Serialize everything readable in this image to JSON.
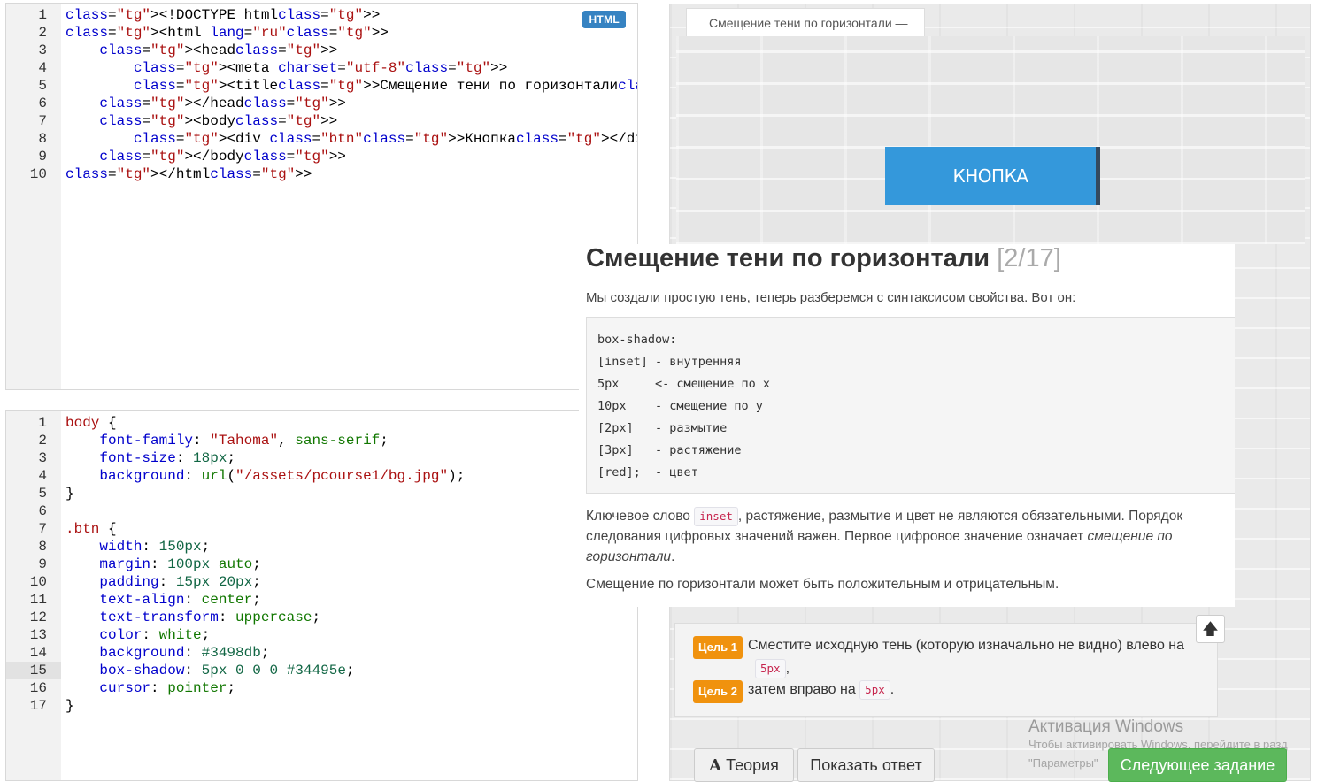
{
  "html_editor": {
    "badge": "HTML",
    "lines": [
      {
        "n": "1",
        "code": "<!DOCTYPE html>"
      },
      {
        "n": "2",
        "code": "<html lang=\"ru\">"
      },
      {
        "n": "3",
        "code": "    <head>"
      },
      {
        "n": "4",
        "code": "        <meta charset=\"utf-8\">"
      },
      {
        "n": "5",
        "code": "        <title>Смещение тени по горизонтали</title>"
      },
      {
        "n": "6",
        "code": "    </head>"
      },
      {
        "n": "7",
        "code": "    <body>"
      },
      {
        "n": "8",
        "code": "        <div class=\"btn\">Кнопка</div>"
      },
      {
        "n": "9",
        "code": "    </body>"
      },
      {
        "n": "10",
        "code": "</html>"
      }
    ]
  },
  "css_editor": {
    "active_line": 15,
    "lines": [
      {
        "n": "1",
        "code": "body {"
      },
      {
        "n": "2",
        "code": "    font-family: \"Tahoma\", sans-serif;"
      },
      {
        "n": "3",
        "code": "    font-size: 18px;"
      },
      {
        "n": "4",
        "code": "    background: url(\"/assets/pcourse1/bg.jpg\");"
      },
      {
        "n": "5",
        "code": "}"
      },
      {
        "n": "6",
        "code": ""
      },
      {
        "n": "7",
        "code": ".btn {"
      },
      {
        "n": "8",
        "code": "    width: 150px;"
      },
      {
        "n": "9",
        "code": "    margin: 100px auto;"
      },
      {
        "n": "10",
        "code": "    padding: 15px 20px;"
      },
      {
        "n": "11",
        "code": "    text-align: center;"
      },
      {
        "n": "12",
        "code": "    text-transform: uppercase;"
      },
      {
        "n": "13",
        "code": "    color: white;"
      },
      {
        "n": "14",
        "code": "    background: #3498db;"
      },
      {
        "n": "15",
        "code": "    box-shadow: 5px 0 0 0 #34495e;"
      },
      {
        "n": "16",
        "code": "    cursor: pointer;"
      },
      {
        "n": "17",
        "code": "}"
      }
    ]
  },
  "preview": {
    "tab_title": "Смещение тени по горизонтали —",
    "button_label": "Кнопка"
  },
  "theory": {
    "title": "Смещение тени по горизонтали",
    "counter": "[2/17]",
    "intro": "Мы создали простую тень, теперь разберемся с синтаксисом свойства. Вот он:",
    "pre_lines": [
      "box-shadow:",
      "[inset] - внутренняя",
      "5px     <- смещение по x",
      "10px    - смещение по y",
      "[2px]   - размытие",
      "[3px]   - растяжение",
      "[red];  - цвет"
    ],
    "p2_before": "Ключевое слово ",
    "p2_code": "inset",
    "p2_after": ", растяжение, размытие и цвет не являются обязательными. Порядок следования цифровых значений важен. Первое цифровое значение означает ",
    "p2_em": "смещение по горизонтали",
    "p2_end": ".",
    "p3": "Смещение по горизонтали может быть положительным и отрицательным."
  },
  "goals": [
    {
      "badge": "Цель 1",
      "text": "Сместите исходную тень (которую изначально не видно) влево на",
      "code": "5px",
      "tail": ","
    },
    {
      "badge": "Цель 2",
      "text": "затем вправо на",
      "code": "5px",
      "tail": "."
    }
  ],
  "buttons": {
    "theory": "Теория",
    "show_answer": "Показать ответ",
    "next": "Следующее задание",
    "up_arrow": "🡅"
  },
  "watermark": {
    "title": "Активация Windows",
    "line2": "Чтобы активировать Windows, перейдите в разд",
    "line3": "\"Параметры\""
  },
  "colors": {
    "accent_blue": "#3498db",
    "shadow_dark": "#34495e",
    "goal_orange": "#f0920e",
    "next_green": "#5cb85c"
  }
}
